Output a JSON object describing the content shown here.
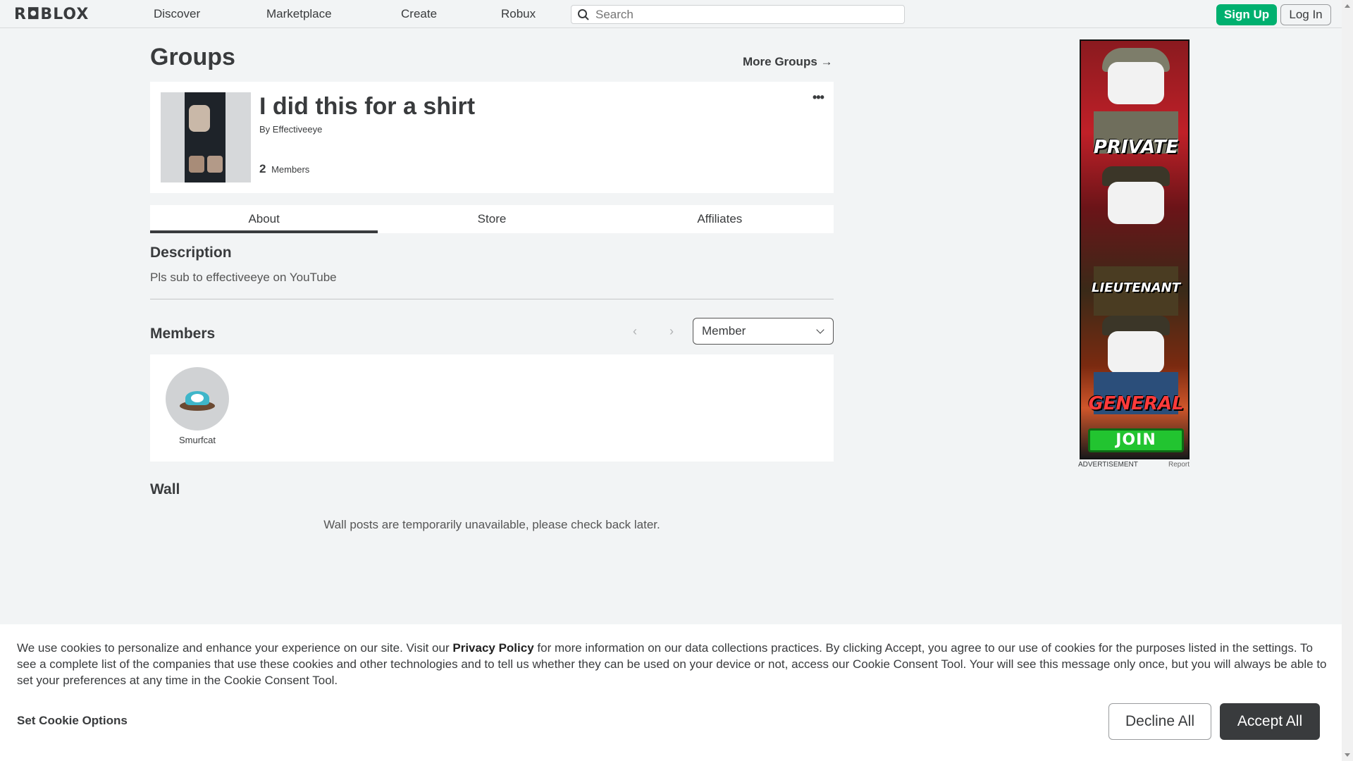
{
  "nav": {
    "logo": "R◘BLOX",
    "links": [
      "Discover",
      "Marketplace",
      "Create",
      "Robux"
    ],
    "search_placeholder": "Search",
    "signup": "Sign Up",
    "login": "Log In"
  },
  "page": {
    "title": "Groups",
    "more_groups": "More Groups →"
  },
  "group": {
    "name": "I did this for a shirt",
    "by_label": "By",
    "owner": "Effectiveeye",
    "member_count": "2",
    "members_label": "Members",
    "menu_glyph": "•••"
  },
  "tabs": [
    "About",
    "Store",
    "Affiliates"
  ],
  "about": {
    "description_title": "Description",
    "description": "Pls sub to effectiveeye on YouTube",
    "members_title": "Members",
    "role_selected": "Member",
    "members": [
      {
        "name": "Smurfcat"
      }
    ],
    "wall_title": "Wall",
    "wall_message": "Wall posts are temporarily unavailable, please check back later."
  },
  "ad": {
    "ranks": [
      "PRIVATE",
      "LIEUTENANT",
      "GENERAL"
    ],
    "join": "JOIN",
    "label": "ADVERTISEMENT",
    "report": "Report"
  },
  "cookie": {
    "text_before": "We use cookies to personalize and enhance your experience on our site. Visit our ",
    "link": "Privacy Policy",
    "text_after": " for more information on our data collections practices. By clicking Accept, you agree to our use of cookies for the purposes listed in the settings. To see a complete list of the companies that use these cookies and other technologies and to tell us whether they can be used on your device or not, access our Cookie Consent Tool. Your will see this message only once, but you will always be able to set your preferences at any time in the Cookie Consent Tool.",
    "options": "Set Cookie Options",
    "decline": "Decline All",
    "accept": "Accept All"
  },
  "colors": {
    "accent_green": "#00b06f",
    "dark_button": "#393b3d",
    "page_bg": "#f2f4f5"
  }
}
